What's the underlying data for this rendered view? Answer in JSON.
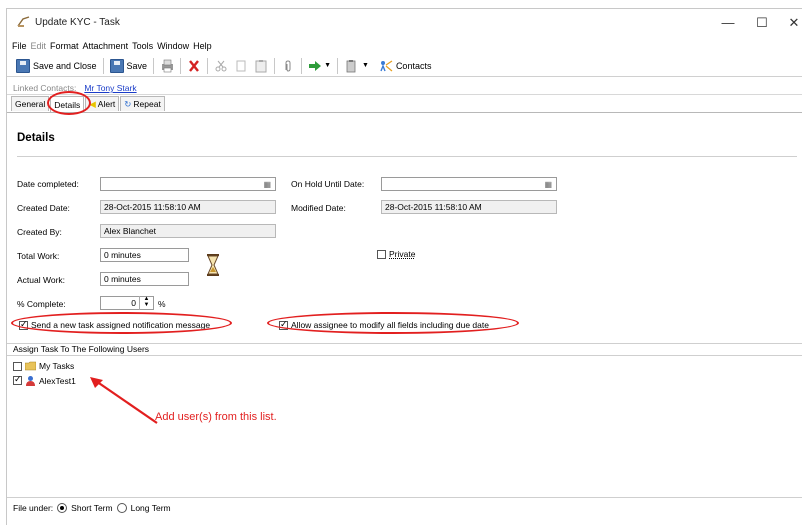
{
  "window": {
    "title": "Update KYC - Task",
    "controls": {
      "minimize": "—",
      "maximize": "☐",
      "close": "✕"
    }
  },
  "menu": [
    "File",
    "Edit",
    "Format",
    "Attachment",
    "Tools",
    "Window",
    "Help"
  ],
  "toolbar": {
    "save_close_label": "Save and Close",
    "save_label": "Save",
    "contacts_label": "Contacts"
  },
  "linked_contacts": {
    "label": "Linked Contacts:",
    "value": "Mr Tony Stark"
  },
  "tabs": [
    {
      "label": "General",
      "active": false
    },
    {
      "label": "Details",
      "active": true
    },
    {
      "label": "Alert",
      "active": false
    },
    {
      "label": "Repeat",
      "active": false
    }
  ],
  "details": {
    "title": "Details",
    "date_completed_label": "Date completed:",
    "date_completed_value": "",
    "on_hold_label": "On Hold Until Date:",
    "on_hold_value": "",
    "created_date_label": "Created Date:",
    "created_date_value": "28-Oct-2015 11:58:10 AM",
    "modified_date_label": "Modified Date:",
    "modified_date_value": "28-Oct-2015 11:58:10 AM",
    "created_by_label": "Created By:",
    "created_by_value": "Alex Blanchet",
    "total_work_label": "Total Work:",
    "total_work_value": "0 minutes",
    "actual_work_label": "Actual Work:",
    "actual_work_value": "0 minutes",
    "percent_complete_label": "% Complete:",
    "percent_complete_value": "0",
    "percent_unit": "%",
    "private_label": "Private",
    "private_checked": false,
    "send_notification_label": "Send a new task assigned notification message",
    "send_notification_checked": true,
    "allow_modify_label": "Allow assignee to modify all fields including due date",
    "allow_modify_checked": true
  },
  "assign": {
    "header": "Assign Task To The Following Users",
    "users": [
      {
        "name": "My Tasks",
        "checked": false
      },
      {
        "name": "AlexTest1",
        "checked": true
      }
    ]
  },
  "annotation": "Add user(s) from this list.",
  "file_under": {
    "label": "File under:",
    "options": [
      {
        "label": "Short Term",
        "selected": true
      },
      {
        "label": "Long Term",
        "selected": false
      }
    ]
  },
  "colors": {
    "highlight": "#e21f1f",
    "link": "#1a3cc8"
  }
}
